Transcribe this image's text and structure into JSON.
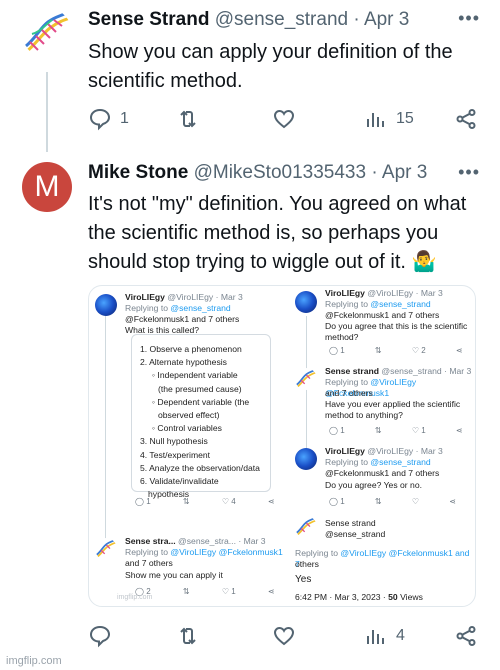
{
  "tweet1": {
    "name": "Sense Strand",
    "handle": "@sense_strand",
    "separator": "·",
    "date": "Apr 3",
    "more_icon": "more-icon",
    "text_line1": "Show you can apply your definition of the",
    "text_line2": "scientific method.",
    "reply_count": "1",
    "views_count": "15"
  },
  "tweet2": {
    "name": "Mike Stone",
    "handle": "@MikeSto01335433",
    "separator": "·",
    "date": "Apr 3",
    "avatar_letter": "M",
    "text_line1": "It's not \"my\" definition. You agreed on what",
    "text_line2": "the scientific method is, so perhaps you",
    "text_line3": "should stop trying to wiggle out of it. 🤷‍♂️",
    "views_count": "4"
  },
  "shot": {
    "left1": {
      "name": "ViroLIEgy",
      "handle": "@ViroLIEgy · Mar 3",
      "replying": "Replying to",
      "replying_to": "@sense_strand",
      "replying_to2": "@Fckelonmusk1 and 7 others",
      "question": "What is this called?",
      "steps": [
        "1. Observe a phenomenon",
        "2. Alternate hypothesis",
        "◦ Independent variable",
        "(the presumed cause)",
        "◦ Dependent variable (the",
        "observed effect)",
        "◦ Control variables",
        "3. Null hypothesis",
        "4. Test/experiment",
        "5. Analyze the observation/data",
        "6. Validate/invalidate",
        "hypothesis"
      ],
      "acts": [
        "1",
        "",
        "4",
        ""
      ]
    },
    "left2": {
      "name": "Sense stra...",
      "handle": "@sense_stra... · Mar 3",
      "replying": "Replying to",
      "replying_to": "@ViroLIEgy @Fckelonmusk1",
      "replying_to2": "and 7 others",
      "text": "Show me you can apply it",
      "acts": [
        "2",
        "",
        "1",
        ""
      ]
    },
    "right1": {
      "name": "ViroLIEgy",
      "handle": "@ViroLIEgy · Mar 3",
      "replying": "Replying to",
      "replying_to": "@sense_strand",
      "replying_to2": "@Fckelonmusk1 and 7 others",
      "text1": "Do you agree that this is the scientific",
      "text2": "method?",
      "acts": [
        "1",
        "",
        "2",
        ""
      ]
    },
    "right2": {
      "name": "Sense strand",
      "handle": "@sense_strand · Mar 3",
      "replying": "Replying to",
      "replying_to": "@ViroLIEgy @Fckelonmusk1",
      "replying_to2": "and 7 others",
      "text1": "Have you ever applied the scientific",
      "text2": "method to anything?",
      "acts": [
        "1",
        "",
        "1",
        ""
      ]
    },
    "right3": {
      "name": "ViroLIEgy",
      "handle": "@ViroLIEgy · Mar 3",
      "replying": "Replying to",
      "replying_to": "@sense_strand",
      "replying_to2": "@Fckelonmusk1 and 7 others",
      "text": "Do you agree? Yes or no.",
      "acts": [
        "1",
        "",
        "",
        ""
      ]
    },
    "right4": {
      "name": "Sense strand",
      "handle": "@sense_strand",
      "replying": "Replying to",
      "replying_to": "@ViroLIEgy @Fckelonmusk1 and 7",
      "replying_to2": "others",
      "text": "Yes",
      "meta": "6:42 PM · Mar 3, 2023 ·",
      "views": "50",
      "views_label": "Views"
    }
  },
  "footer": {
    "watermark": "imgflip.com"
  }
}
